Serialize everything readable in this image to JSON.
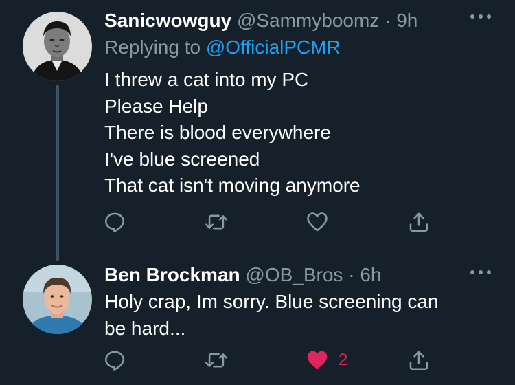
{
  "colors": {
    "background": "#15202b",
    "secondary_text": "#8899a6",
    "link": "#1da1f2",
    "like_active": "#e0245e",
    "thread_line": "#3d5466"
  },
  "tweets": [
    {
      "display_name": "Sanicwowguy",
      "handle": "@Sammyboomz",
      "separator": "·",
      "time": "9h",
      "replying_prefix": "Replying to",
      "replying_to": "@OfficialPCMR",
      "lines": [
        "I threw a cat into my PC",
        "Please Help",
        "There is blood everywhere",
        "I've blue screened",
        "That cat isn't moving anymore"
      ],
      "avatar_icon": "avatar",
      "more_icon": "more-horizontal-icon",
      "actions": {
        "reply_icon": "reply-icon",
        "retweet_icon": "retweet-icon",
        "like_icon": "heart-outline-icon",
        "share_icon": "share-icon"
      }
    },
    {
      "display_name": "Ben Brockman",
      "handle": "@OB_Bros",
      "separator": "·",
      "time": "6h",
      "lines": [
        "Holy crap, Im sorry. Blue screening can",
        "be hard..."
      ],
      "avatar_icon": "avatar",
      "more_icon": "more-horizontal-icon",
      "actions": {
        "reply_icon": "reply-icon",
        "retweet_icon": "retweet-icon",
        "like_icon": "heart-filled-icon",
        "like_count": "2",
        "share_icon": "share-icon"
      }
    }
  ]
}
